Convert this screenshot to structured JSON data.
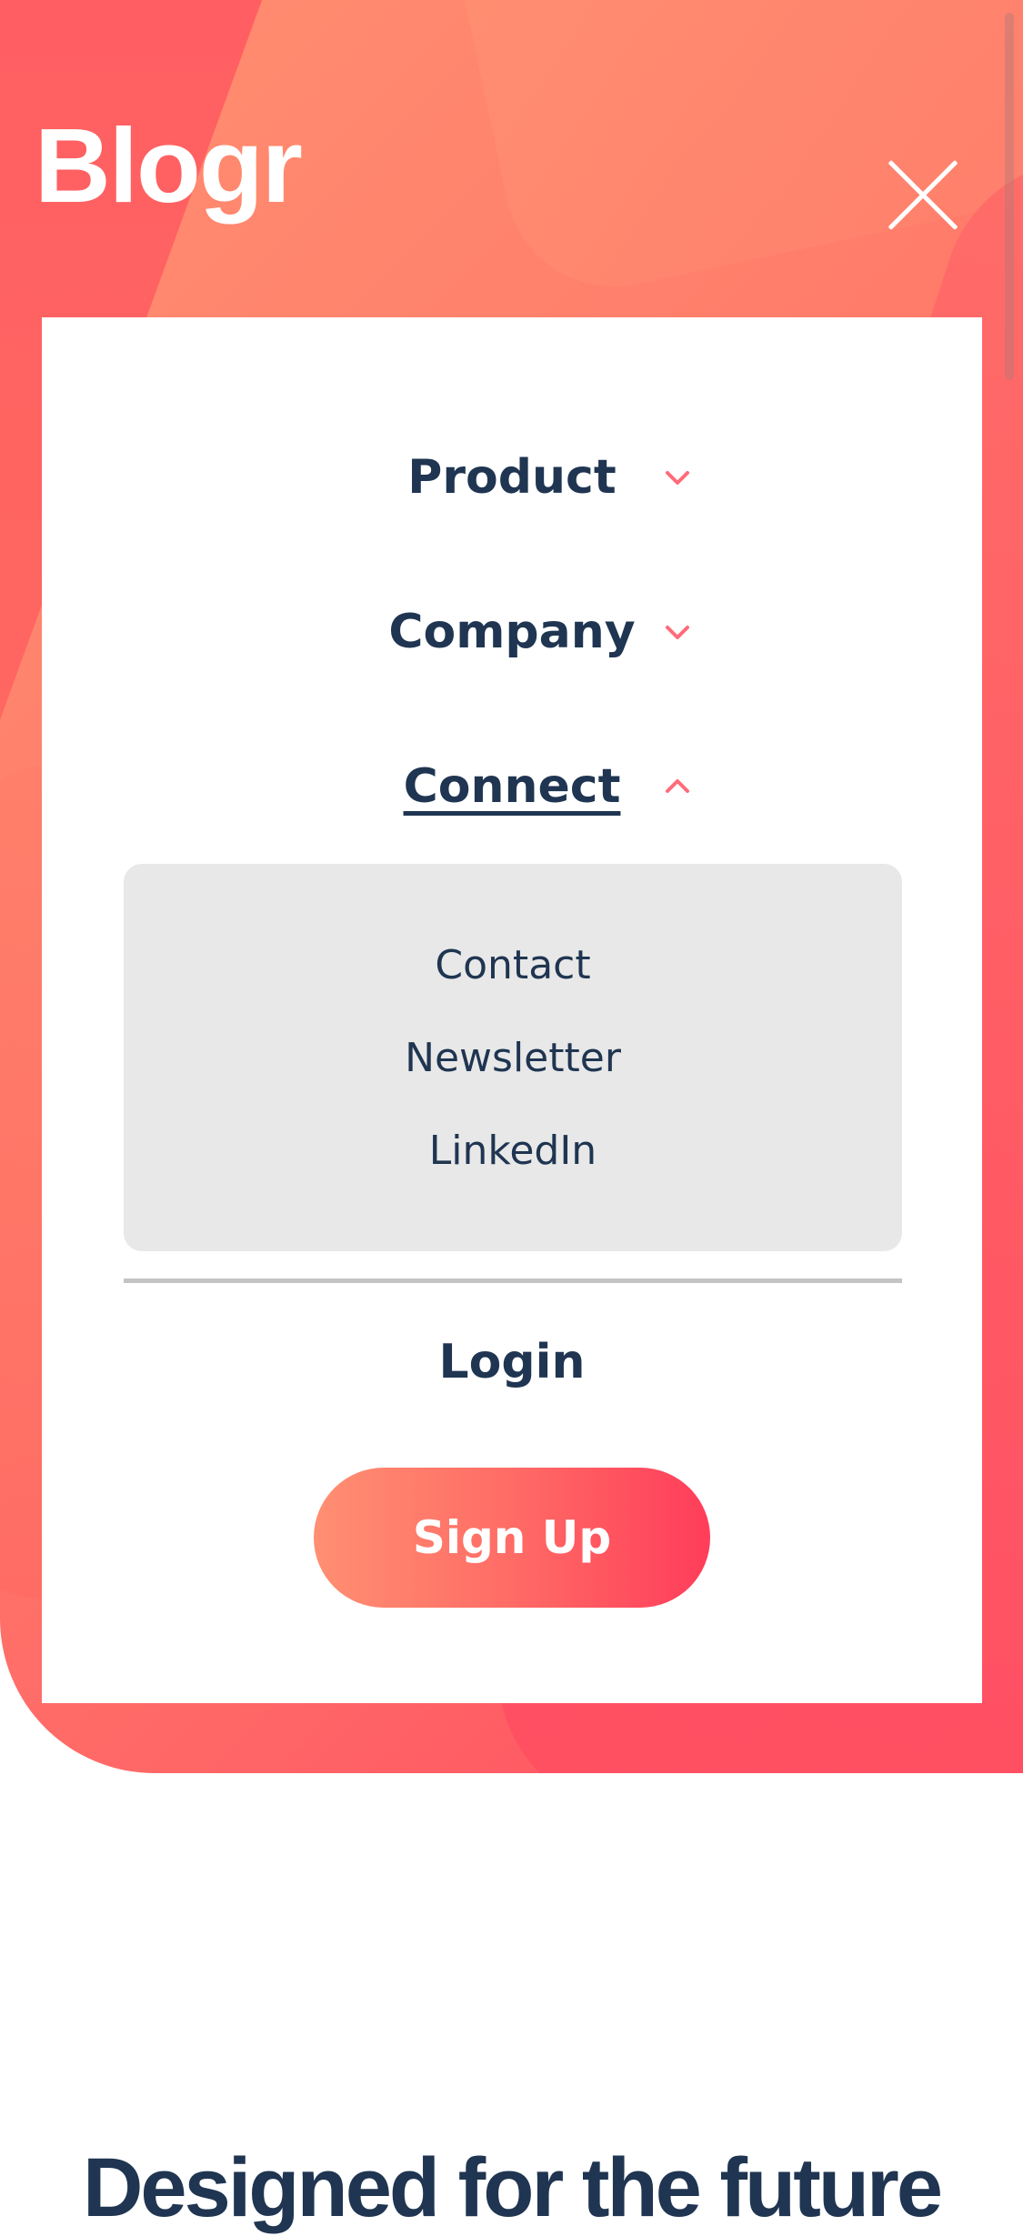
{
  "brand": {
    "logo": "Blogr"
  },
  "menu": {
    "items": [
      {
        "label": "Product",
        "state": "collapsed"
      },
      {
        "label": "Company",
        "state": "collapsed"
      },
      {
        "label": "Connect",
        "state": "expanded"
      }
    ],
    "connect_submenu": [
      {
        "label": "Contact"
      },
      {
        "label": "Newsletter"
      },
      {
        "label": "LinkedIn"
      }
    ],
    "login_label": "Login",
    "signup_label": "Sign Up"
  },
  "main": {
    "heading": "Designed for the future"
  },
  "colors": {
    "text_primary": "#1f3551",
    "accent": "#ff4d62",
    "submenu_background": "#e8e8e8",
    "chevron": "#ff6b7a"
  },
  "icons": {
    "close": "close-icon",
    "chevron_down": "chevron-down-icon",
    "chevron_up": "chevron-up-icon"
  }
}
